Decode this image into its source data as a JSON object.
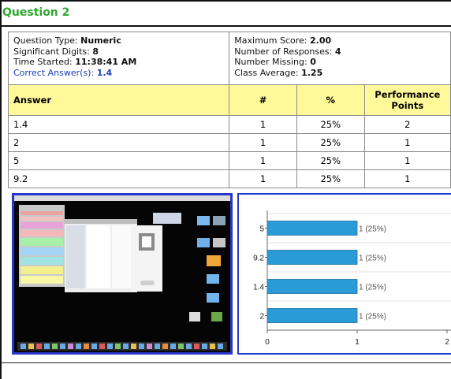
{
  "title": "Question 2",
  "info": {
    "qtype_label": "Question Type: ",
    "qtype_value": "Numeric",
    "sig_label": "Significant Digits: ",
    "sig_value": "8",
    "time_label": "Time Started: ",
    "time_value": "11:38:41 AM",
    "correct_label": "Correct Answer(s): ",
    "correct_value": "1.4",
    "max_label": "Maximum Score: ",
    "max_value": "2.00",
    "resp_label": "Number of Responses: ",
    "resp_value": "4",
    "missing_label": "Number Missing: ",
    "missing_value": "0",
    "avg_label": "Class Average: ",
    "avg_value": "1.25"
  },
  "table": {
    "headers": [
      "Answer",
      "#",
      "%",
      "Performance\nPoints"
    ],
    "rows": [
      [
        "1.4",
        "1",
        "25%",
        "2"
      ],
      [
        "2",
        "1",
        "25%",
        "1"
      ],
      [
        "5",
        "1",
        "25%",
        "1"
      ],
      [
        "9.2",
        "1",
        "25%",
        "1"
      ]
    ]
  },
  "colors": {
    "accent_title": "#2fa82f",
    "header_bg": "#fff999",
    "bar": "#2b9bd8",
    "frame_blue": "#2637c9"
  },
  "chart_data": {
    "type": "bar",
    "orientation": "horizontal",
    "categories": [
      "5",
      "9.2",
      "1.4",
      "2"
    ],
    "values": [
      1,
      1,
      1,
      1
    ],
    "labels": [
      "1 (25%)",
      "1 (25%)",
      "1 (25%)",
      "1 (25%)"
    ],
    "xlim": [
      0,
      2
    ],
    "xticks": [
      "0",
      "1",
      "2"
    ],
    "grid": true
  }
}
